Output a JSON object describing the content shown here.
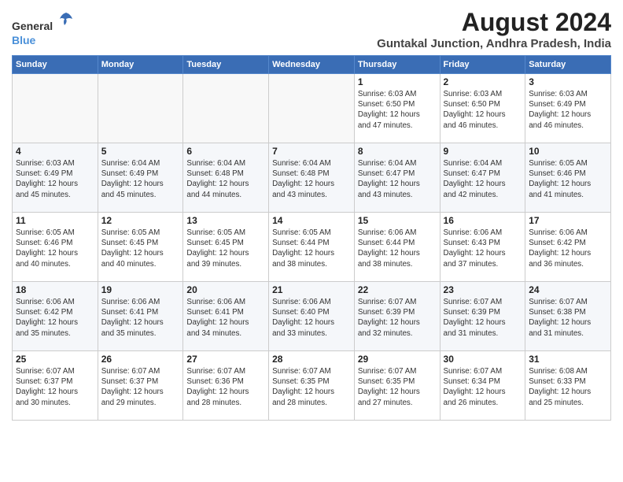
{
  "header": {
    "logo_general": "General",
    "logo_blue": "Blue",
    "main_title": "August 2024",
    "subtitle": "Guntakal Junction, Andhra Pradesh, India"
  },
  "weekdays": [
    "Sunday",
    "Monday",
    "Tuesday",
    "Wednesday",
    "Thursday",
    "Friday",
    "Saturday"
  ],
  "weeks": [
    [
      {
        "day": "",
        "detail": ""
      },
      {
        "day": "",
        "detail": ""
      },
      {
        "day": "",
        "detail": ""
      },
      {
        "day": "",
        "detail": ""
      },
      {
        "day": "1",
        "detail": "Sunrise: 6:03 AM\nSunset: 6:50 PM\nDaylight: 12 hours\nand 47 minutes."
      },
      {
        "day": "2",
        "detail": "Sunrise: 6:03 AM\nSunset: 6:50 PM\nDaylight: 12 hours\nand 46 minutes."
      },
      {
        "day": "3",
        "detail": "Sunrise: 6:03 AM\nSunset: 6:49 PM\nDaylight: 12 hours\nand 46 minutes."
      }
    ],
    [
      {
        "day": "4",
        "detail": "Sunrise: 6:03 AM\nSunset: 6:49 PM\nDaylight: 12 hours\nand 45 minutes."
      },
      {
        "day": "5",
        "detail": "Sunrise: 6:04 AM\nSunset: 6:49 PM\nDaylight: 12 hours\nand 45 minutes."
      },
      {
        "day": "6",
        "detail": "Sunrise: 6:04 AM\nSunset: 6:48 PM\nDaylight: 12 hours\nand 44 minutes."
      },
      {
        "day": "7",
        "detail": "Sunrise: 6:04 AM\nSunset: 6:48 PM\nDaylight: 12 hours\nand 43 minutes."
      },
      {
        "day": "8",
        "detail": "Sunrise: 6:04 AM\nSunset: 6:47 PM\nDaylight: 12 hours\nand 43 minutes."
      },
      {
        "day": "9",
        "detail": "Sunrise: 6:04 AM\nSunset: 6:47 PM\nDaylight: 12 hours\nand 42 minutes."
      },
      {
        "day": "10",
        "detail": "Sunrise: 6:05 AM\nSunset: 6:46 PM\nDaylight: 12 hours\nand 41 minutes."
      }
    ],
    [
      {
        "day": "11",
        "detail": "Sunrise: 6:05 AM\nSunset: 6:46 PM\nDaylight: 12 hours\nand 40 minutes."
      },
      {
        "day": "12",
        "detail": "Sunrise: 6:05 AM\nSunset: 6:45 PM\nDaylight: 12 hours\nand 40 minutes."
      },
      {
        "day": "13",
        "detail": "Sunrise: 6:05 AM\nSunset: 6:45 PM\nDaylight: 12 hours\nand 39 minutes."
      },
      {
        "day": "14",
        "detail": "Sunrise: 6:05 AM\nSunset: 6:44 PM\nDaylight: 12 hours\nand 38 minutes."
      },
      {
        "day": "15",
        "detail": "Sunrise: 6:06 AM\nSunset: 6:44 PM\nDaylight: 12 hours\nand 38 minutes."
      },
      {
        "day": "16",
        "detail": "Sunrise: 6:06 AM\nSunset: 6:43 PM\nDaylight: 12 hours\nand 37 minutes."
      },
      {
        "day": "17",
        "detail": "Sunrise: 6:06 AM\nSunset: 6:42 PM\nDaylight: 12 hours\nand 36 minutes."
      }
    ],
    [
      {
        "day": "18",
        "detail": "Sunrise: 6:06 AM\nSunset: 6:42 PM\nDaylight: 12 hours\nand 35 minutes."
      },
      {
        "day": "19",
        "detail": "Sunrise: 6:06 AM\nSunset: 6:41 PM\nDaylight: 12 hours\nand 35 minutes."
      },
      {
        "day": "20",
        "detail": "Sunrise: 6:06 AM\nSunset: 6:41 PM\nDaylight: 12 hours\nand 34 minutes."
      },
      {
        "day": "21",
        "detail": "Sunrise: 6:06 AM\nSunset: 6:40 PM\nDaylight: 12 hours\nand 33 minutes."
      },
      {
        "day": "22",
        "detail": "Sunrise: 6:07 AM\nSunset: 6:39 PM\nDaylight: 12 hours\nand 32 minutes."
      },
      {
        "day": "23",
        "detail": "Sunrise: 6:07 AM\nSunset: 6:39 PM\nDaylight: 12 hours\nand 31 minutes."
      },
      {
        "day": "24",
        "detail": "Sunrise: 6:07 AM\nSunset: 6:38 PM\nDaylight: 12 hours\nand 31 minutes."
      }
    ],
    [
      {
        "day": "25",
        "detail": "Sunrise: 6:07 AM\nSunset: 6:37 PM\nDaylight: 12 hours\nand 30 minutes."
      },
      {
        "day": "26",
        "detail": "Sunrise: 6:07 AM\nSunset: 6:37 PM\nDaylight: 12 hours\nand 29 minutes."
      },
      {
        "day": "27",
        "detail": "Sunrise: 6:07 AM\nSunset: 6:36 PM\nDaylight: 12 hours\nand 28 minutes."
      },
      {
        "day": "28",
        "detail": "Sunrise: 6:07 AM\nSunset: 6:35 PM\nDaylight: 12 hours\nand 28 minutes."
      },
      {
        "day": "29",
        "detail": "Sunrise: 6:07 AM\nSunset: 6:35 PM\nDaylight: 12 hours\nand 27 minutes."
      },
      {
        "day": "30",
        "detail": "Sunrise: 6:07 AM\nSunset: 6:34 PM\nDaylight: 12 hours\nand 26 minutes."
      },
      {
        "day": "31",
        "detail": "Sunrise: 6:08 AM\nSunset: 6:33 PM\nDaylight: 12 hours\nand 25 minutes."
      }
    ]
  ]
}
